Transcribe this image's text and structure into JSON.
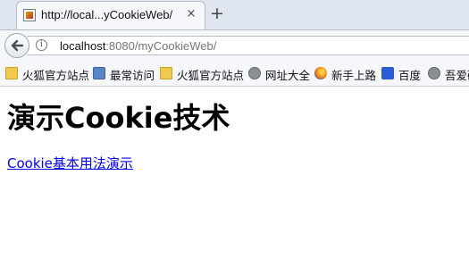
{
  "tab": {
    "title": "http://local...yCookieWeb/",
    "close_glyph": "×",
    "new_tab_glyph": "+"
  },
  "address_bar": {
    "host": "localhost",
    "rest": ":8080/myCookieWeb/"
  },
  "bookmarks": [
    {
      "label": "火狐官方站点",
      "icon": "folder-icon"
    },
    {
      "label": "最常访问",
      "icon": "most-visited-icon"
    },
    {
      "label": "火狐官方站点",
      "icon": "folder-icon"
    },
    {
      "label": "网址大全",
      "icon": "globe-icon"
    },
    {
      "label": "新手上路",
      "icon": "firefox-icon"
    },
    {
      "label": "百度",
      "icon": "baidu-paw-icon"
    },
    {
      "label": "吾爱破",
      "icon": "globe-icon"
    }
  ],
  "page": {
    "heading": "演示Cookie技术",
    "link": "Cookie基本用法演示"
  }
}
